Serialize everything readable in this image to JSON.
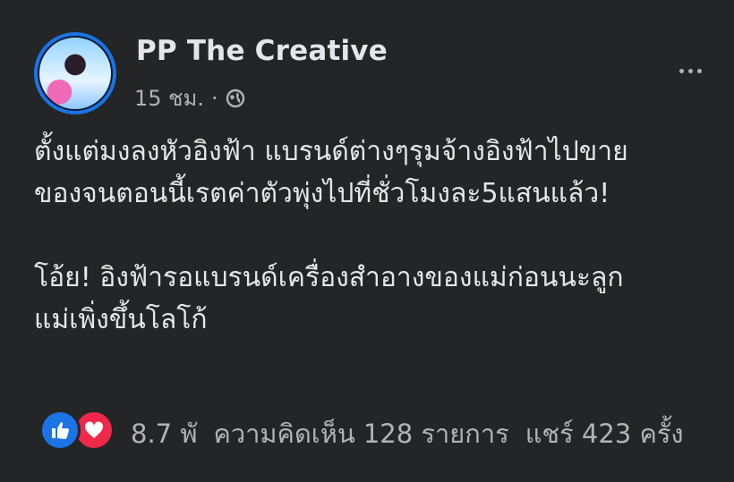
{
  "post": {
    "page_name": "PP The Creative",
    "time": "15 ชม.",
    "separator": "·",
    "privacy_icon": "globe-icon",
    "menu_icon": "more-options-icon",
    "lines": [
      "ตั้งแต่มงลงหัวอิงฟ้า แบรนด์ต่างๆรุมจ้างอิงฟ้าไปขาย",
      "ของจนตอนนี้เรตค่าตัวพุ่งไปที่ชั่วโมงละ5แสนแล้ว!",
      "โอ้ย! อิงฟ้ารอแบรนด์เครื่องสำอางของแม่ก่อนนะลูก",
      "แม่เพิ่งขึ้นโลโก้"
    ]
  },
  "footer": {
    "reaction_icons": [
      "like-icon",
      "love-icon"
    ],
    "reaction_count": "8.7 พั",
    "comments": "ความคิดเห็น 128 รายการ",
    "shares": "แชร์ 423 ครั้ง"
  },
  "colors": {
    "background": "#242526",
    "primary_text": "#e4e6eb",
    "secondary_text": "#b0b3b8",
    "accent": "#1b74e4",
    "love": "#f02849"
  }
}
